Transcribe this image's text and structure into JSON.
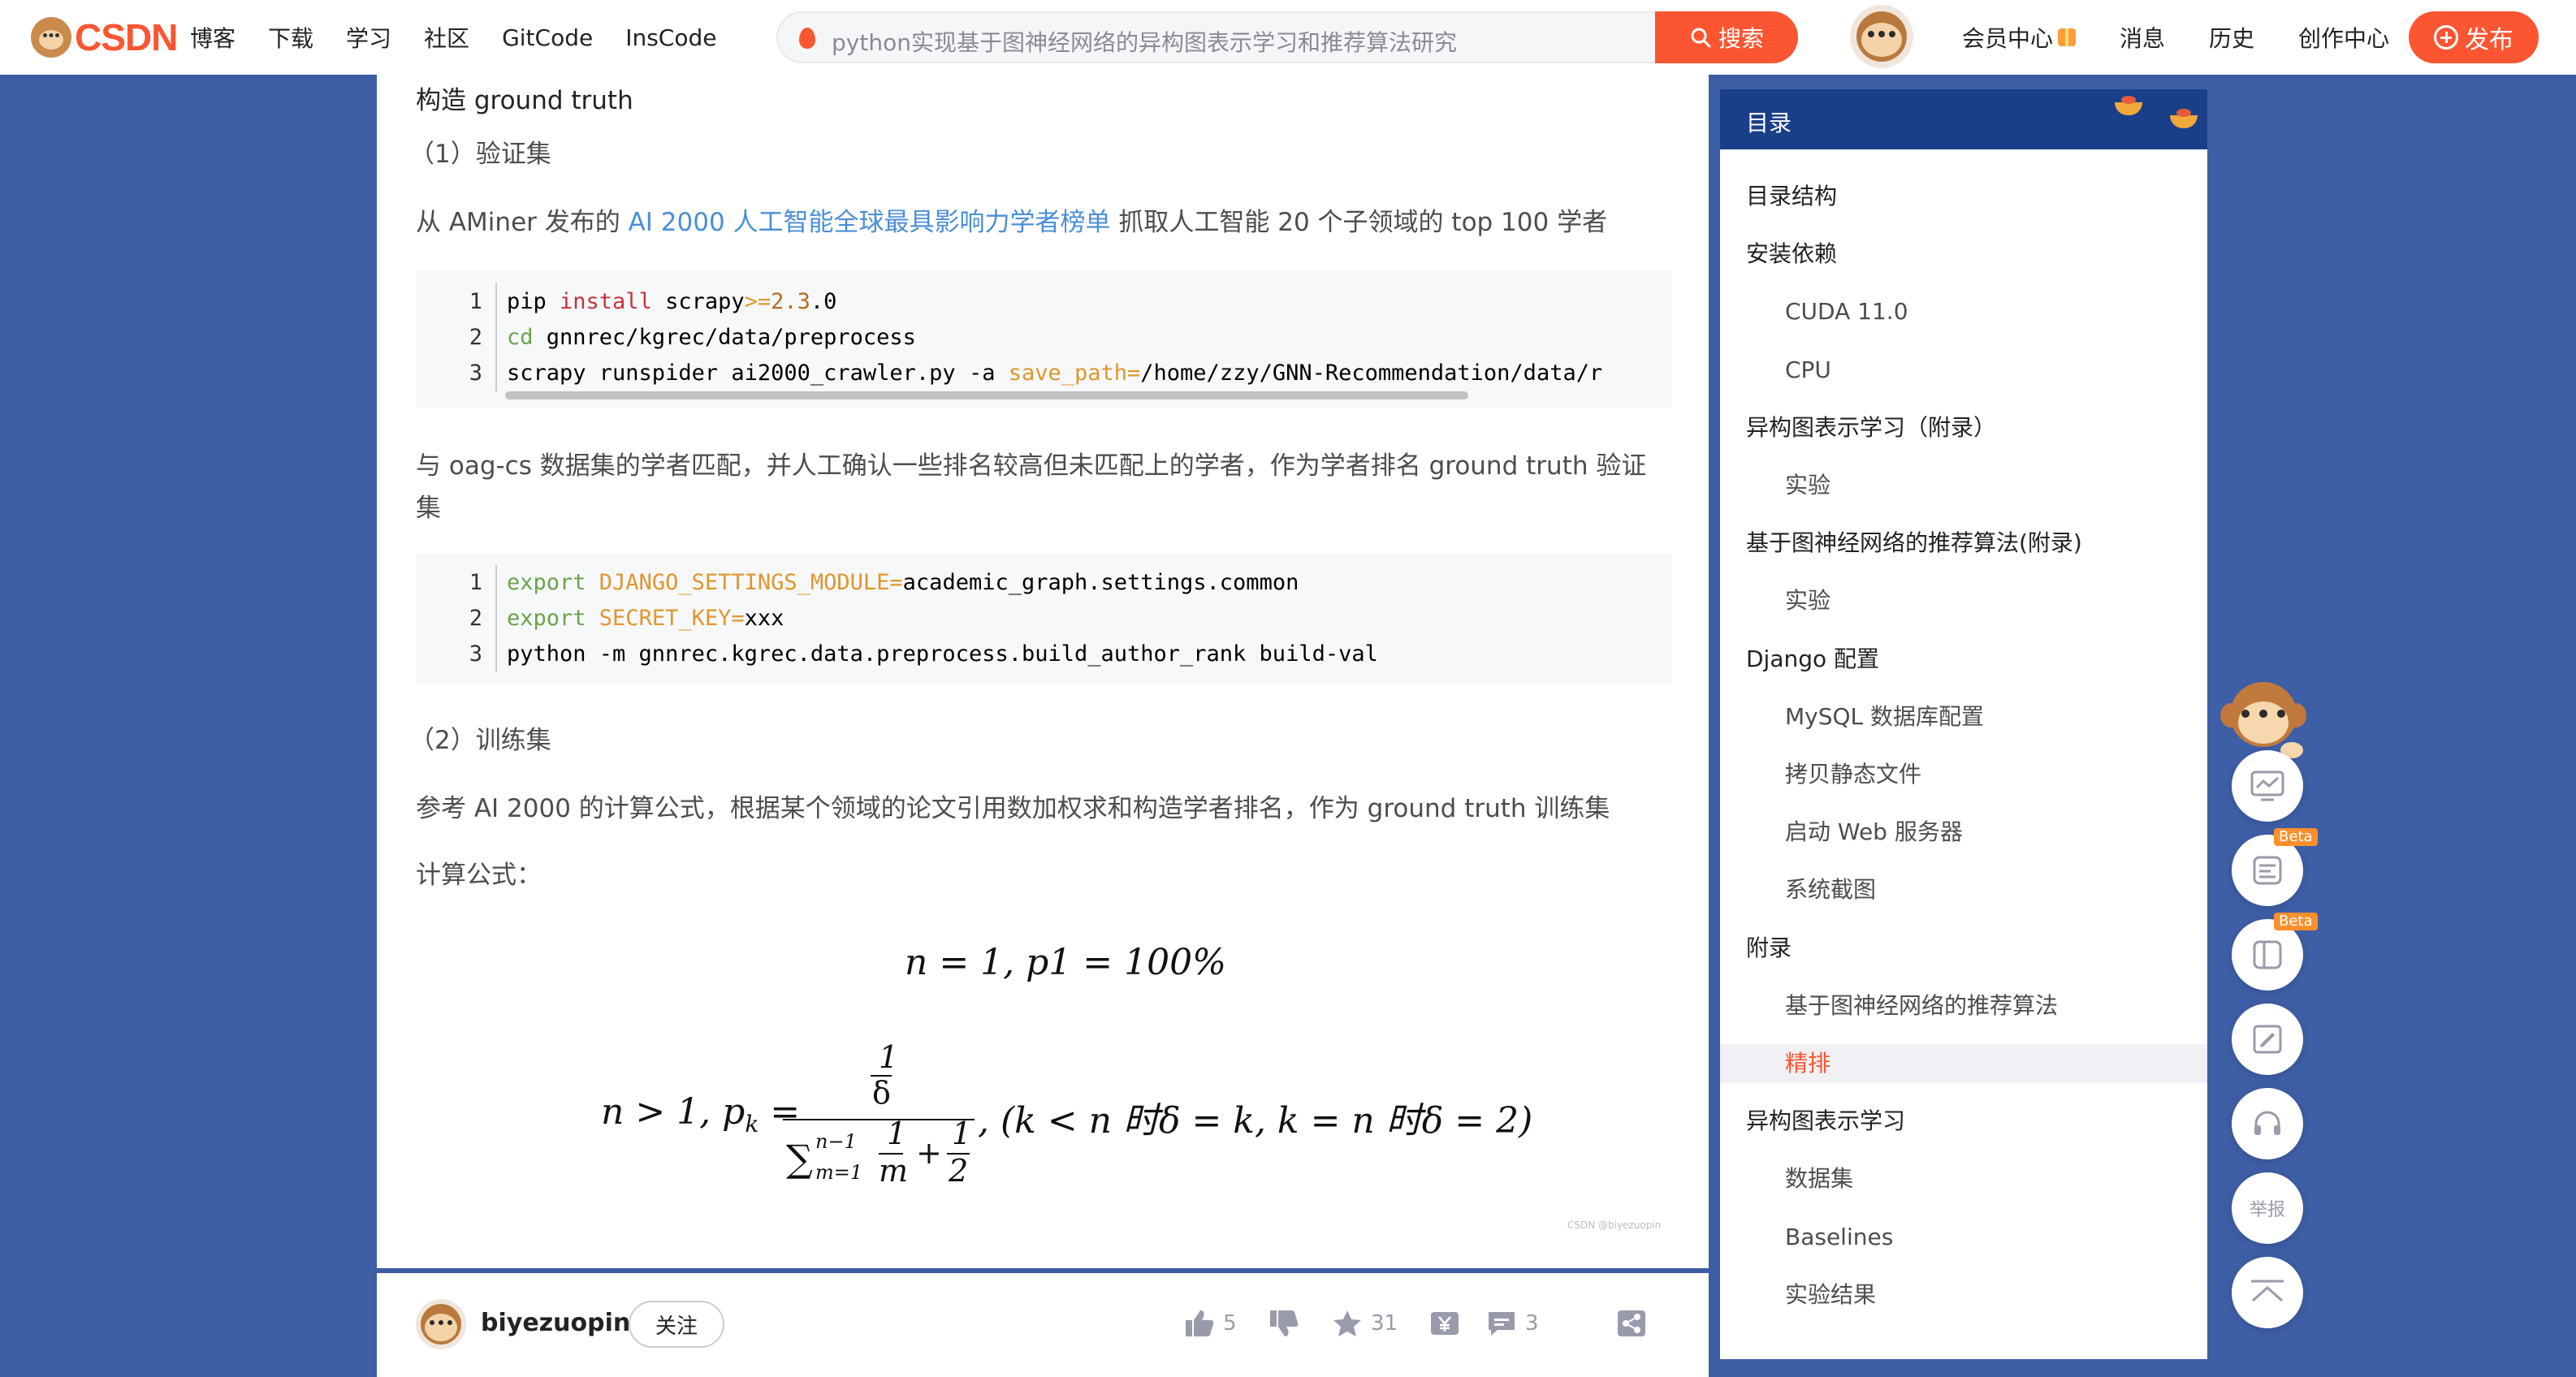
{
  "header": {
    "logo_text": "CSDN",
    "nav": [
      "博客",
      "下载",
      "学习",
      "社区",
      "GitCode",
      "InsCode"
    ],
    "search_placeholder": "python实现基于图神经网络的异构图表示学习和推荐算法研究",
    "search_button": "搜索",
    "right_nav": [
      "会员中心",
      "消息",
      "历史",
      "创作中心"
    ],
    "publish_button": "发布"
  },
  "article": {
    "heading_ground_truth": "构造 ground truth",
    "sub_validation": "（1）验证集",
    "para1_prefix": "从 AMiner 发布的 ",
    "para1_link": "AI 2000 人工智能全球最具影响力学者榜单",
    "para1_suffix": " 抓取人工智能 20 个子领域的 top 100 学者",
    "code1": {
      "line_numbers": [
        "1",
        "2",
        "3"
      ],
      "lines": [
        [
          {
            "t": "pip ",
            "c": ""
          },
          {
            "t": "install",
            "c": "kw-red"
          },
          {
            "t": " scrapy",
            "c": ""
          },
          {
            "t": ">=",
            "c": "kw-orange"
          },
          {
            "t": "2.3",
            "c": "kw-brown"
          },
          {
            "t": ".0",
            "c": ""
          }
        ],
        [
          {
            "t": "cd",
            "c": "kw-green"
          },
          {
            "t": " gnnrec/kgrec/data/preprocess",
            "c": ""
          }
        ],
        [
          {
            "t": "scrapy runspider ai2000_crawler.py -a ",
            "c": ""
          },
          {
            "t": "save_path=",
            "c": "kw-orange"
          },
          {
            "t": "/home/zzy/GNN-Recommendation/data/r",
            "c": ""
          }
        ]
      ]
    },
    "para2_line1": "与 oag-cs 数据集的学者匹配，并人工确认一些排名较高但未匹配上的学者，作为学者排名 ground truth 验证",
    "para2_line2": "集",
    "code2": {
      "line_numbers": [
        "1",
        "2",
        "3"
      ],
      "lines": [
        [
          {
            "t": "export ",
            "c": "kw-green"
          },
          {
            "t": "DJANGO_SETTINGS_MODULE=",
            "c": "kw-orange"
          },
          {
            "t": "academic_graph.settings.common",
            "c": ""
          }
        ],
        [
          {
            "t": "export ",
            "c": "kw-green"
          },
          {
            "t": "SECRET_KEY=",
            "c": "kw-orange"
          },
          {
            "t": "xxx",
            "c": ""
          }
        ],
        [
          {
            "t": "python -m gnnrec.kgrec.data.preprocess.build_author_rank build-val",
            "c": ""
          }
        ]
      ]
    },
    "sub_training": "（2）训练集",
    "para3": "参考 AI 2000 的计算公式，根据某个领域的论文引用数加权求和构造学者排名，作为 ground truth 训练集",
    "para4": "计算公式：",
    "formula1": "n = 1, p1 = 100%",
    "formula2_left": "n > 1, p",
    "formula2_sub": "k",
    "formula2_eq": " =",
    "formula2_num": "1",
    "formula2_num_den": "δ",
    "formula2_sum": "∑",
    "formula2_sum_sup": "n−1",
    "formula2_sum_sub": "m=1",
    "formula2_frac1_num": "1",
    "formula2_frac1_den": "m",
    "formula2_plus": "+",
    "formula2_frac2_num": "1",
    "formula2_frac2_den": "2",
    "formula2_right": ", (k < n 时δ = k, k = n 时δ = 2)",
    "watermark": "CSDN @biyezuopin"
  },
  "author_bar": {
    "name": "biyezuopin",
    "follow": "关注",
    "likes": "5",
    "favorites": "31",
    "comments": "3"
  },
  "toc": {
    "title": "目录",
    "items": [
      {
        "label": "目录结构",
        "level": 1
      },
      {
        "label": "安装依赖",
        "level": 1
      },
      {
        "label": "CUDA 11.0",
        "level": 2
      },
      {
        "label": "CPU",
        "level": 2
      },
      {
        "label": "异构图表示学习（附录）",
        "level": 1
      },
      {
        "label": "实验",
        "level": 2
      },
      {
        "label": "基于图神经网络的推荐算法(附录)",
        "level": 1
      },
      {
        "label": "实验",
        "level": 2
      },
      {
        "label": "Django 配置",
        "level": 1
      },
      {
        "label": "MySQL 数据库配置",
        "level": 2
      },
      {
        "label": "拷贝静态文件",
        "level": 2
      },
      {
        "label": "启动 Web 服务器",
        "level": 2
      },
      {
        "label": "系统截图",
        "level": 2
      },
      {
        "label": "附录",
        "level": 1
      },
      {
        "label": "基于图神经网络的推荐算法",
        "level": 2
      },
      {
        "label": "精排",
        "level": 2,
        "active": true
      },
      {
        "label": "异构图表示学习",
        "level": 1
      },
      {
        "label": "数据集",
        "level": 2
      },
      {
        "label": "Baselines",
        "level": 2
      },
      {
        "label": "实验结果",
        "level": 2
      }
    ]
  },
  "float_toolbar": {
    "beta": "Beta",
    "report": "举报"
  },
  "colors": {
    "brand": "#fc5531",
    "page_bg": "#3e5ea6",
    "toc_header": "#1a3f89",
    "link": "#4a8ed8"
  }
}
